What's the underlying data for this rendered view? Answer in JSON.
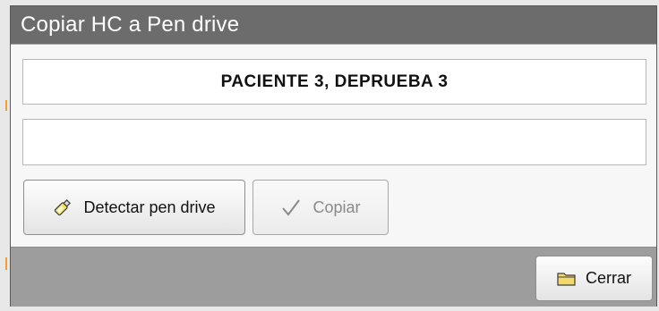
{
  "window": {
    "title": "Copiar HC a Pen drive"
  },
  "patient": {
    "name": "PACIENTE 3, DEPRUEBA 3"
  },
  "status_box": {
    "value": ""
  },
  "buttons": {
    "detect": {
      "label": "Detectar pen drive",
      "icon": "usb-drive-icon",
      "enabled": true
    },
    "copy": {
      "label": "Copiar",
      "icon": "checkmark-icon",
      "enabled": false
    },
    "close": {
      "label": "Cerrar",
      "icon": "folder-icon",
      "enabled": true
    }
  },
  "colors": {
    "titlebar": "#6c6c6c",
    "footer": "#9d9d9d",
    "disabled_text": "#8a8a8a"
  }
}
